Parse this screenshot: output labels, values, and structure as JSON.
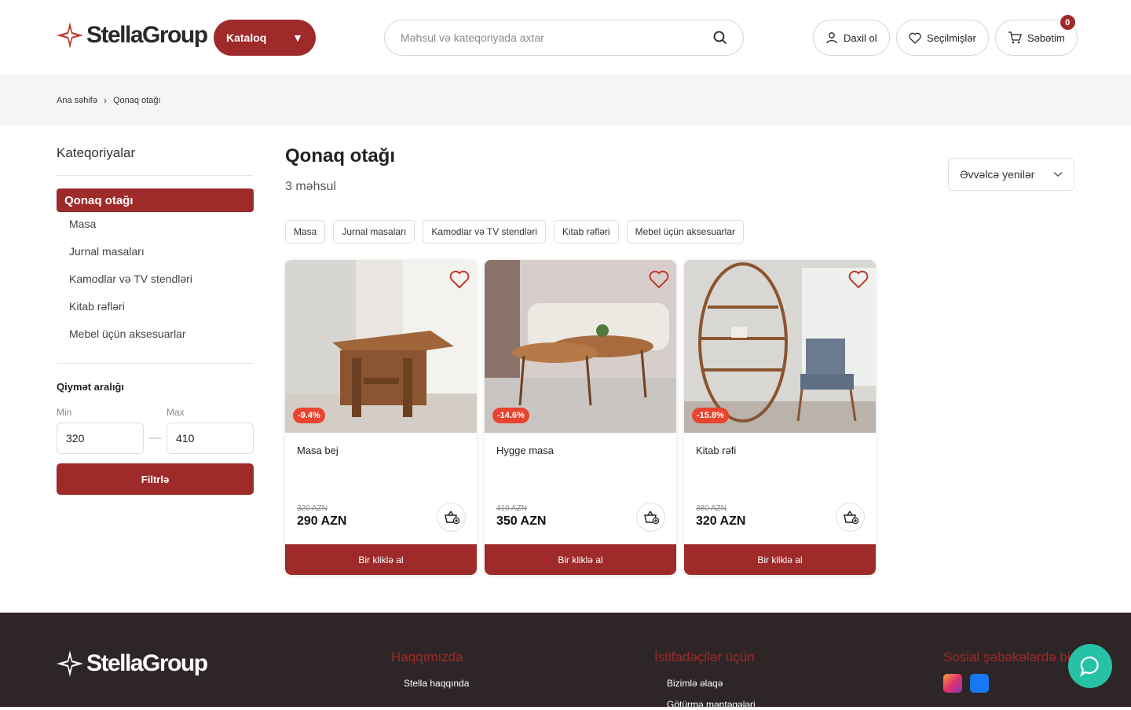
{
  "header": {
    "logo": "StellaGroup",
    "catalog_label": "Kataloq",
    "search_placeholder": "Məhsul və kateqoriyada axtar",
    "login_label": "Daxil ol",
    "favorites_label": "Seçilmişlər",
    "cart_label": "Səbətim",
    "cart_count": "0"
  },
  "breadcrumb": {
    "home": "Ana səhifə",
    "current": "Qonaq otağı"
  },
  "sidebar": {
    "title": "Kateqoriyalar",
    "active": "Qonaq otağı",
    "items": [
      "Masa",
      "Jurnal masaları",
      "Kamodlar və TV stendləri",
      "Kitab rəfləri",
      "Mebel üçün aksesuarlar"
    ],
    "price_title": "Qiymət aralığı",
    "min_label": "Min",
    "max_label": "Max",
    "min_value": "320",
    "max_value": "410",
    "filter_label": "Filtrlə"
  },
  "main": {
    "title": "Qonaq otağı",
    "count": "3 məhsul",
    "sort_label": "Əvvəlcə yenilər",
    "chips": [
      "Masa",
      "Jurnal masaları",
      "Kamodlar və TV stendləri",
      "Kitab rəfləri",
      "Mebel üçün aksesuarlar"
    ],
    "products": [
      {
        "name": "Masa bej",
        "discount": "-9.4%",
        "old_price": "320 AZN",
        "price": "290 AZN",
        "buy_label": "Bir kliklə al"
      },
      {
        "name": "Hygge masa",
        "discount": "-14.6%",
        "old_price": "410 AZN",
        "price": "350 AZN",
        "buy_label": "Bir kliklə al"
      },
      {
        "name": "Kitab rəfi",
        "discount": "-15.8%",
        "old_price": "380 AZN",
        "price": "320 AZN",
        "buy_label": "Bir kliklə al"
      }
    ]
  },
  "footer": {
    "logo": "StellaGroup",
    "about_title": "Haqqımızda",
    "about_link": "Stella haqqında",
    "users_title": "İstifadəçilər üçün",
    "users_link1": "Bizimlə əlaqə",
    "users_link2": "Götürmə məntəqələri",
    "social_title": "Sosial şəbəkələrdə biz"
  },
  "colors": {
    "brand": "#9f2a2a",
    "discount": "#e8442e",
    "chat": "#27c2a6",
    "footer": "#2e2626"
  }
}
